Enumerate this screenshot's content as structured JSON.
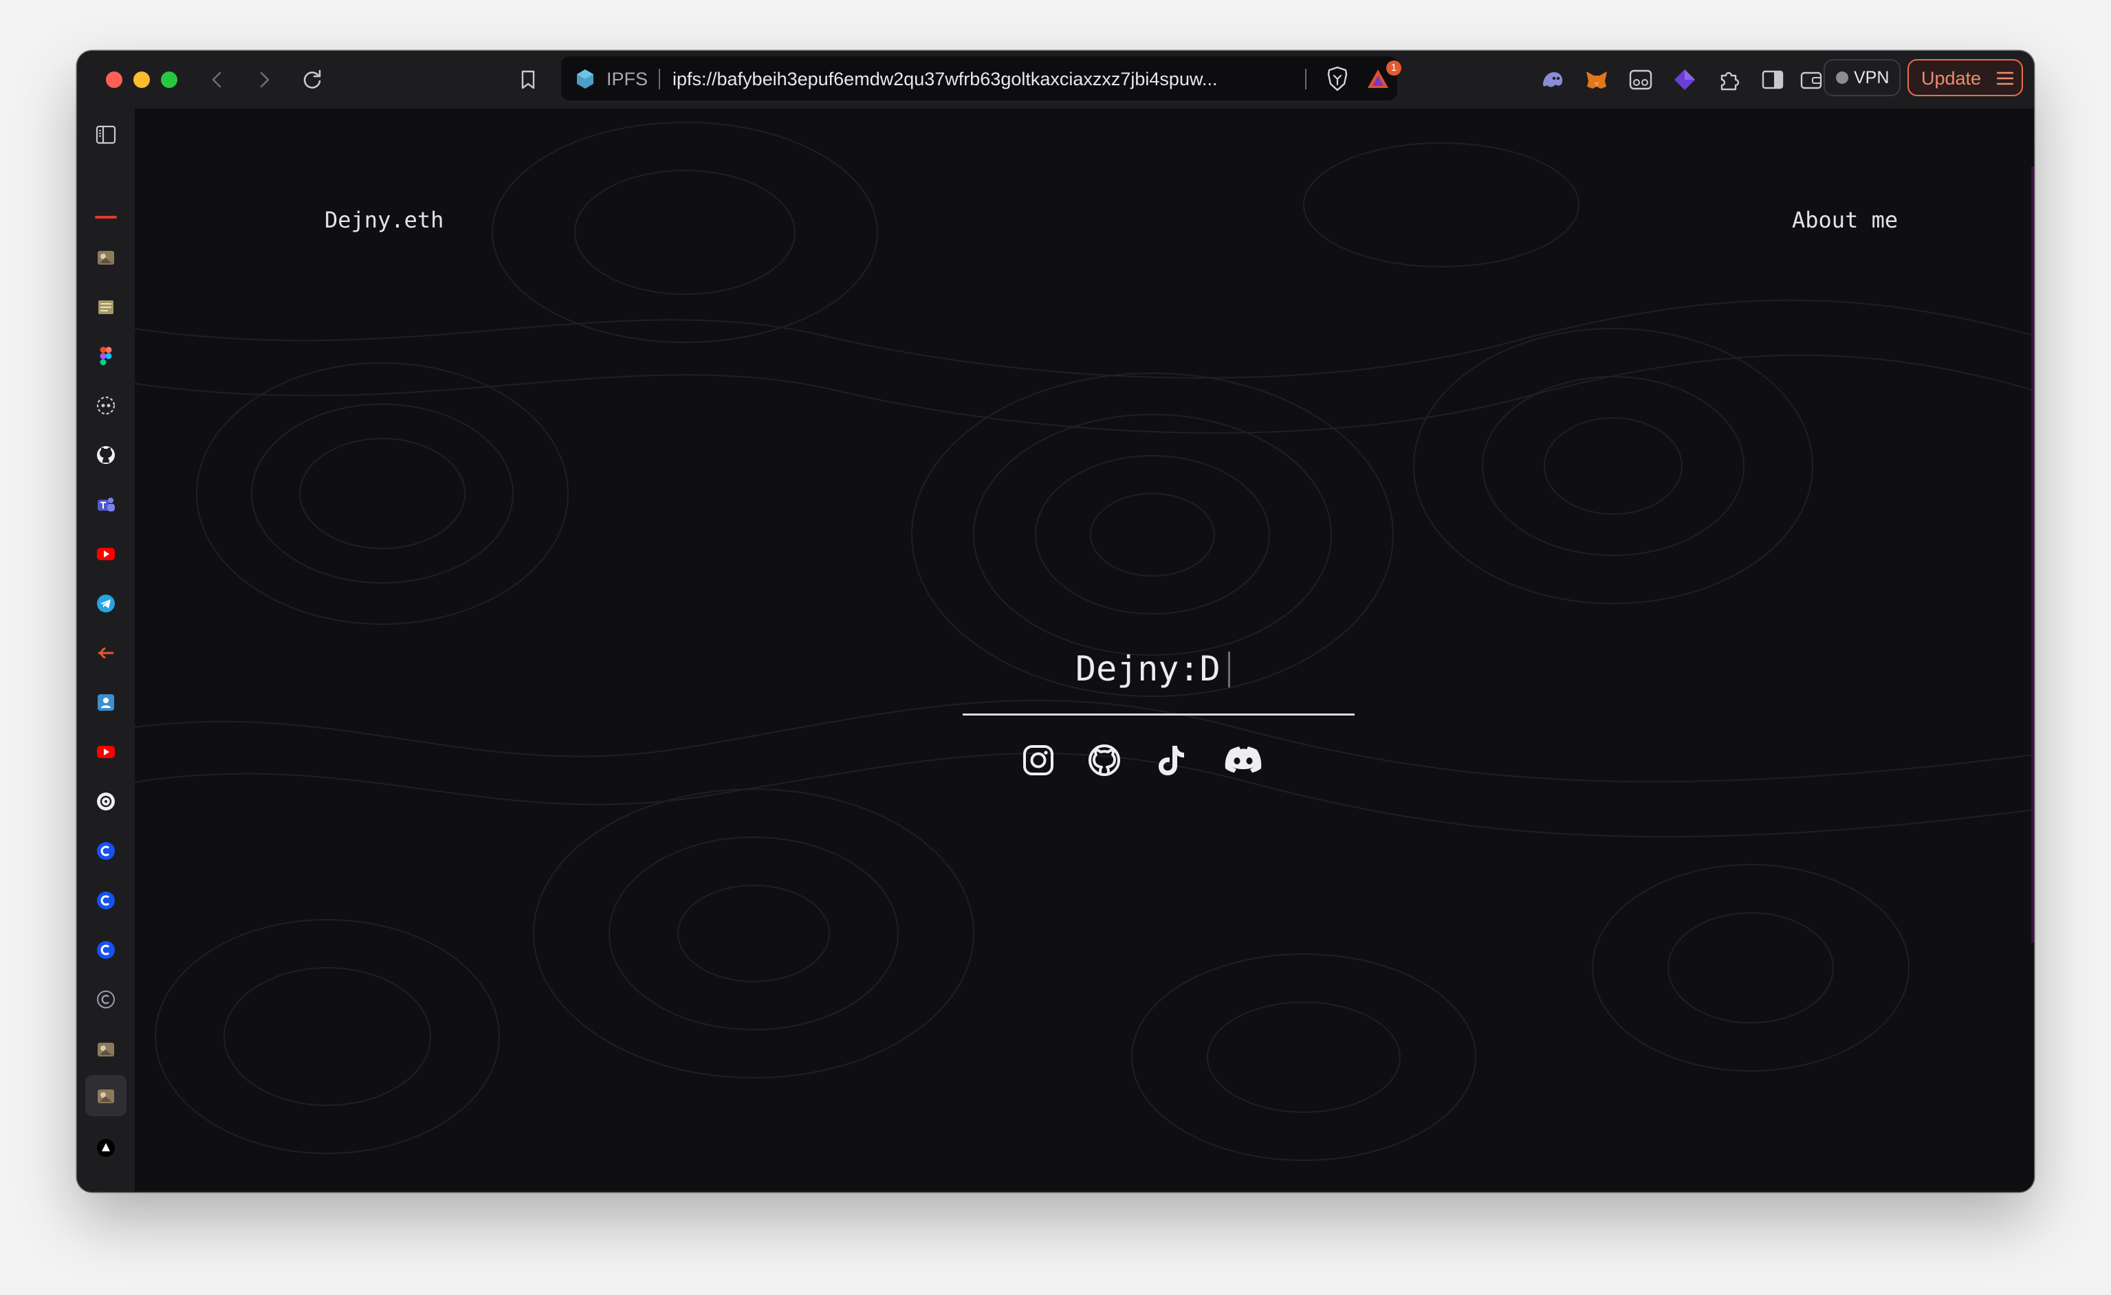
{
  "browser": {
    "url_scheme_label": "IPFS",
    "url": "ipfs://bafybeih3epuf6emdw2qu37wfrb63goltkaxciaxzxz7jbi4spuw...",
    "rewards_badge_count": "1",
    "vpn_label": "VPN",
    "update_label": "Update",
    "colors": {
      "update_accent": "#ef6b4f",
      "badge": "#e65a30"
    }
  },
  "sidebar": {
    "items": [
      "sidebar-toggle-icon",
      "reading-list-icon",
      "app-icon-1",
      "app-icon-2",
      "figma-icon",
      "app-icon-3",
      "github-icon",
      "teams-icon",
      "youtube-icon",
      "telegram-icon",
      "app-icon-4",
      "contacts-icon",
      "youtube-icon-2",
      "chatgpt-icon",
      "coinbase-icon",
      "coinbase-icon-2",
      "coinbase-icon-3",
      "app-icon-5",
      "app-icon-6",
      "app-icon-7",
      "app-icon-8",
      "add-icon"
    ]
  },
  "site": {
    "logo": "Dejny.eth",
    "nav_about": "About me",
    "hero_title": "Dejny:D",
    "socials": [
      "instagram-icon",
      "github-icon",
      "tiktok-icon",
      "discord-icon"
    ]
  }
}
